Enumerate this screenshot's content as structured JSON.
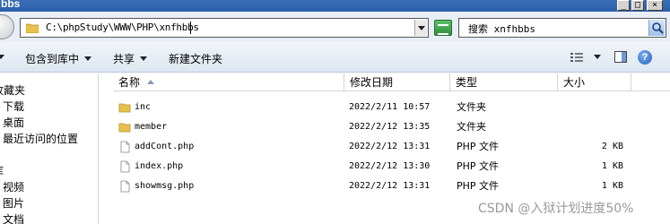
{
  "window": {
    "title": "bbs"
  },
  "address": {
    "path": "C:\\phpStudy\\WWW\\PHP\\xnfhbbs"
  },
  "search": {
    "text": "搜索 xnfhbbs"
  },
  "toolbar": {
    "include_library": "包含到库中",
    "share": "共享",
    "new_folder": "新建文件夹"
  },
  "nav": {
    "items": [
      "收藏夹",
      "下载",
      "桌面",
      "最近访问的位置",
      "库",
      "视频",
      "图片",
      "文档"
    ]
  },
  "columns": {
    "name": "名称",
    "date": "修改日期",
    "type": "类型",
    "size": "大小"
  },
  "files": [
    {
      "name": "inc",
      "date": "2022/2/11 10:57",
      "type": "文件夹",
      "size": "",
      "kind": "folder-icon"
    },
    {
      "name": "member",
      "date": "2022/2/12 13:35",
      "type": "文件夹",
      "size": "",
      "kind": "folder-icon"
    },
    {
      "name": "addCont.php",
      "date": "2022/2/12 13:31",
      "type": "PHP 文件",
      "size": "2 KB",
      "kind": "file-icon"
    },
    {
      "name": "index.php",
      "date": "2022/2/12 13:30",
      "type": "PHP 文件",
      "size": "1 KB",
      "kind": "file-icon"
    },
    {
      "name": "showmsg.php",
      "date": "2022/2/12 13:31",
      "type": "PHP 文件",
      "size": "1 KB",
      "kind": "file-icon"
    }
  ],
  "watermark": "CSDN @入狱计划进度50%",
  "colors": {
    "titlebar": "#2c5fa8",
    "folder": "#e8c24a",
    "accent": "#1f5fb8"
  }
}
